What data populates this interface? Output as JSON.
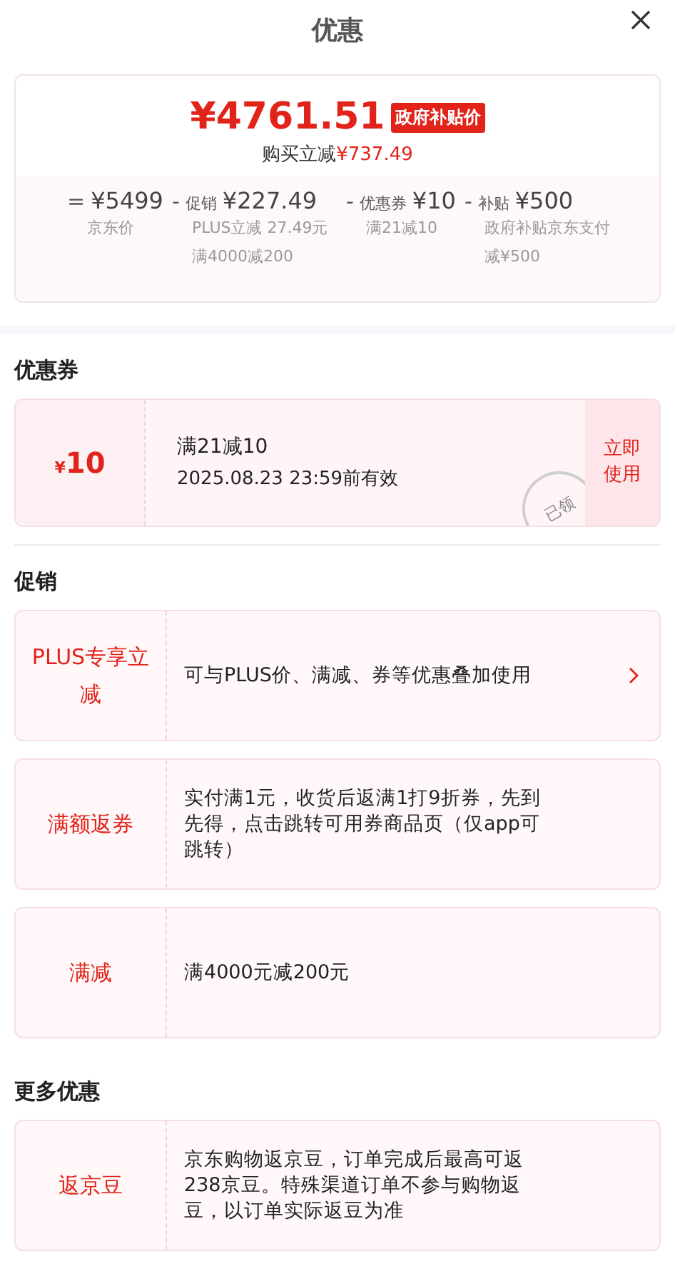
{
  "header": {
    "title": "优惠"
  },
  "summary": {
    "price": "¥4761.51",
    "price_tag": "政府补贴价",
    "saving_label": "购买立减",
    "saving_amount": "¥737.49",
    "breakdown": [
      {
        "operator": "=",
        "amount": "¥5499",
        "notes": [
          "京东价"
        ]
      },
      {
        "operator": "-",
        "label": "促销",
        "amount": "¥227.49",
        "notes": [
          "PLUS立减 27.49元",
          "满4000减200"
        ]
      },
      {
        "operator": "-",
        "label": "优惠券",
        "amount": "¥10",
        "notes": [
          "满21减10"
        ]
      },
      {
        "operator": "-",
        "label": "补贴",
        "amount": "¥500",
        "notes": [
          "政府补贴京东支付减¥500"
        ]
      }
    ]
  },
  "coupon_section": {
    "title": "优惠券",
    "coupons": [
      {
        "currency": "¥",
        "value": "10",
        "condition": "满21减10",
        "validity": "2025.08.23 23:59前有效",
        "stamp": "已领",
        "action": "立即使用"
      }
    ]
  },
  "promo_section": {
    "title": "促销",
    "items": [
      {
        "tag": "PLUS专享立减",
        "description": "可与PLUS价、满减、券等优惠叠加使用",
        "has_arrow": true
      },
      {
        "tag": "满额返券",
        "description": "实付满1元，收货后返满1打9折券，先到先得，点击跳转可用券商品页（仅app可跳转）",
        "has_arrow": false
      },
      {
        "tag": "满减",
        "description": "满4000元减200元",
        "has_arrow": false
      }
    ]
  },
  "more_section": {
    "title": "更多优惠",
    "items": [
      {
        "tag": "返京豆",
        "description": "京东购物返京豆，订单完成后最高可返238京豆。特殊渠道订单不参与购物返豆，以订单实际返豆为准",
        "has_arrow": false
      }
    ]
  }
}
